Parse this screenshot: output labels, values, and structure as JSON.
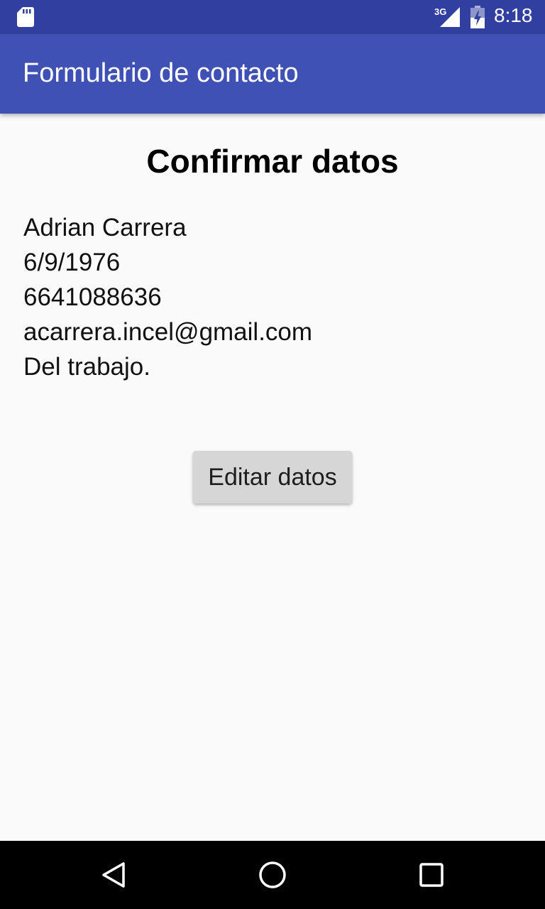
{
  "status_bar": {
    "network_type": "3G",
    "time": "8:18",
    "background_color": "#3140a0",
    "icons": [
      "sd-card-icon",
      "signal-icon",
      "battery-charging-icon"
    ]
  },
  "app_bar": {
    "title": "Formulario de contacto",
    "background_color": "#3f51b5"
  },
  "main": {
    "heading": "Confirmar datos",
    "details": {
      "name": "Adrian Carrera",
      "birth_date": "6/9/1976",
      "phone": "6641088636",
      "email": "acarrera.incel@gmail.com",
      "description": "Del trabajo."
    },
    "edit_button_label": "Editar datos"
  },
  "nav_bar": {
    "icons": [
      "back-icon",
      "home-icon",
      "recents-icon"
    ]
  }
}
